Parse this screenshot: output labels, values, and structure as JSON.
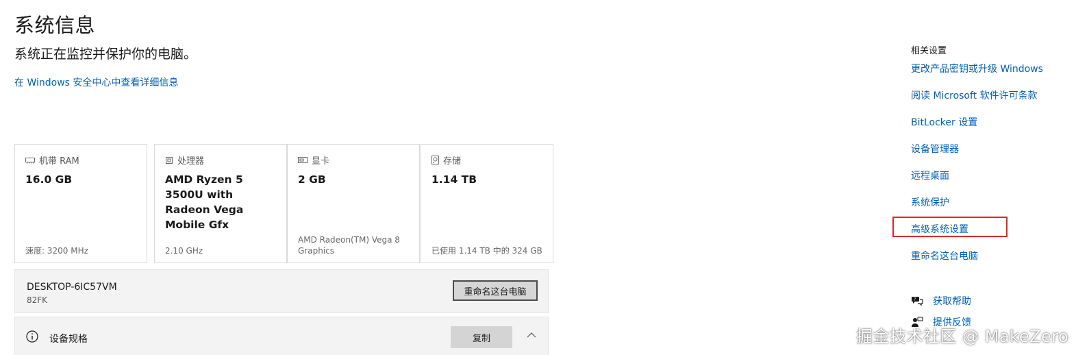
{
  "page": {
    "title": "系统信息",
    "subtitle": "系统正在监控并保护你的电脑。",
    "security_link": "在 Windows 安全中心中查看详细信息"
  },
  "cards": [
    {
      "icon": "ram-icon",
      "caption": "机带 RAM",
      "value": "16.0 GB",
      "footer": "速度: 3200 MHz"
    },
    {
      "icon": "processor-icon",
      "caption": "处理器",
      "value": "AMD Ryzen 5 3500U with Radeon Vega Mobile Gfx",
      "footer": "2.10 GHz"
    },
    {
      "icon": "display-adapter-icon",
      "caption": "显卡",
      "value": "2 GB",
      "footer": "AMD Radeon(TM) Vega 8 Graphics"
    },
    {
      "icon": "storage-icon",
      "caption": "存储",
      "value": "1.14 TB",
      "footer": "已使用 1.14 TB 中的 324 GB"
    }
  ],
  "pc": {
    "name": "DESKTOP-6IC57VM",
    "model": "82FK",
    "rename_button": "重命名这台电脑"
  },
  "specs": {
    "label": "设备规格",
    "copy_button": "复制"
  },
  "related": {
    "heading": "相关设置",
    "links": [
      "更改产品密钥或升级 Windows",
      "阅读 Microsoft 软件许可条款",
      "BitLocker 设置",
      "设备管理器",
      "远程桌面",
      "系统保护",
      "高级系统设置",
      "重命名这台电脑"
    ],
    "highlighted": "高级系统设置"
  },
  "help": {
    "get_help": "获取帮助",
    "feedback": "提供反馈"
  },
  "watermark": "掘金技术社区 @ MakeZero",
  "colors": {
    "link": "#005fb8",
    "highlight_border": "#d42b2b",
    "panel_bg": "#f3f3f3"
  }
}
